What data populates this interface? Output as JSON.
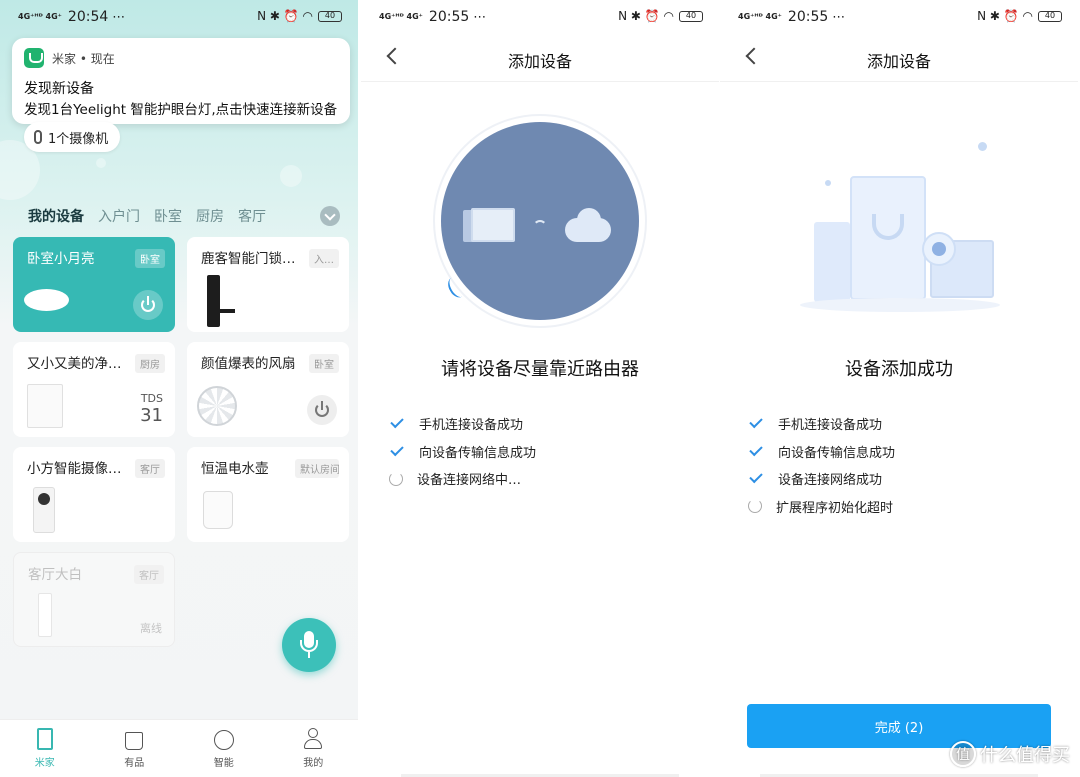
{
  "panel_home": {
    "status": {
      "signal": "4G⁺ᴴᴰ 4G⁺",
      "time": "20:54",
      "right_icons": "N ✱ ⏰ ◠",
      "battery": "40"
    },
    "notification": {
      "app": "米家 • 现在",
      "title": "发现新设备",
      "body": "发现1台Yeelight 智能护眼台灯,点击快速连接新设备"
    },
    "camera_pill": "1个摄像机",
    "tabs": [
      "我的设备",
      "入户门",
      "卧室",
      "厨房",
      "客厅"
    ],
    "devices": [
      {
        "name": "卧室小月亮",
        "room": "卧室"
      },
      {
        "name": "鹿客智能门锁…",
        "room": "入…"
      },
      {
        "name": "又小又美的净…",
        "room": "厨房",
        "metric_label": "TDS",
        "metric_value": "31"
      },
      {
        "name": "颜值爆表的风扇",
        "room": "卧室"
      },
      {
        "name": "小方智能摄像…",
        "room": "客厅"
      },
      {
        "name": "恒温电水壶",
        "room": "默认房间"
      },
      {
        "name": "客厅大白",
        "room": "客厅",
        "state": "离线"
      }
    ],
    "nav": [
      "米家",
      "有品",
      "智能",
      "我的"
    ]
  },
  "panel_connecting": {
    "status": {
      "signal": "4G⁺ᴴᴰ 4G⁺",
      "time": "20:55",
      "right_icons": "N ✱ ⏰ ◠",
      "battery": "40"
    },
    "title": "添加设备",
    "headline": "请将设备尽量靠近路由器",
    "steps": [
      {
        "label": "手机连接设备成功",
        "done": true
      },
      {
        "label": "向设备传输信息成功",
        "done": true
      },
      {
        "label": "设备连接网络中…",
        "done": false
      }
    ]
  },
  "panel_done": {
    "status": {
      "signal": "4G⁺ᴴᴰ 4G⁺",
      "time": "20:55",
      "right_icons": "N ✱ ⏰ ◠",
      "battery": "40"
    },
    "title": "添加设备",
    "headline": "设备添加成功",
    "steps": [
      {
        "label": "手机连接设备成功",
        "done": true
      },
      {
        "label": "向设备传输信息成功",
        "done": true
      },
      {
        "label": "设备连接网络成功",
        "done": true
      },
      {
        "label": "扩展程序初始化超时",
        "done": false
      }
    ],
    "done_button": "完成 (2)",
    "watermark": "什么值得买",
    "watermark_logo": "值"
  },
  "colors": {
    "accent_teal": "#36b9b4",
    "accent_blue": "#1aa1f3",
    "device_circle": "#6f89b1"
  }
}
